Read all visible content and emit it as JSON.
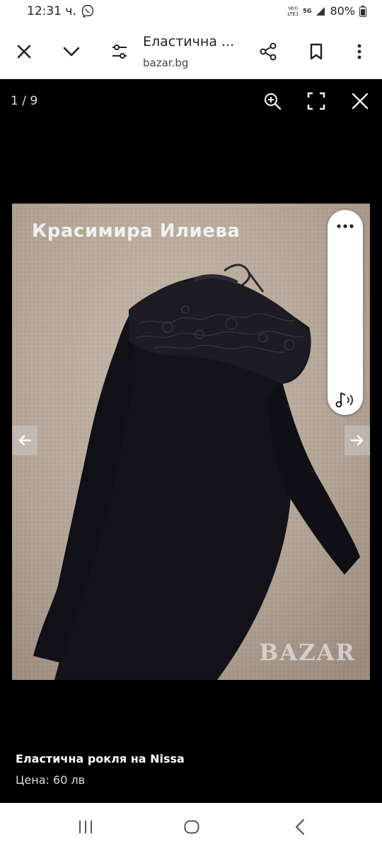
{
  "status_bar": {
    "time": "12:31 ч.",
    "volte": "Vo)) LTE1",
    "network": "5G",
    "battery": "80%"
  },
  "toolbar": {
    "title": "Еластична ...",
    "url": "bazar.bg"
  },
  "viewer": {
    "counter": "1 / 9",
    "watermark_name": "Красимира Илиева",
    "watermark_logo": "BAZAR"
  },
  "caption": {
    "title": "Еластична рокля на Nissa",
    "price": "Цена: 60 лв"
  },
  "colors": {
    "toolbar_bg": "#ffffff",
    "viewer_bg": "#000000",
    "carpet": "#b8a99c",
    "dress": "#121218"
  },
  "icons": [
    "close-icon",
    "chevron-down-icon",
    "tune-icon",
    "share-icon",
    "bookmark-icon",
    "more-vert-icon",
    "zoom-in-icon",
    "fullscreen-icon",
    "arrow-left-icon",
    "arrow-right-icon",
    "more-horiz-icon",
    "read-aloud-icon",
    "recent-apps-icon",
    "home-icon",
    "back-icon"
  ]
}
